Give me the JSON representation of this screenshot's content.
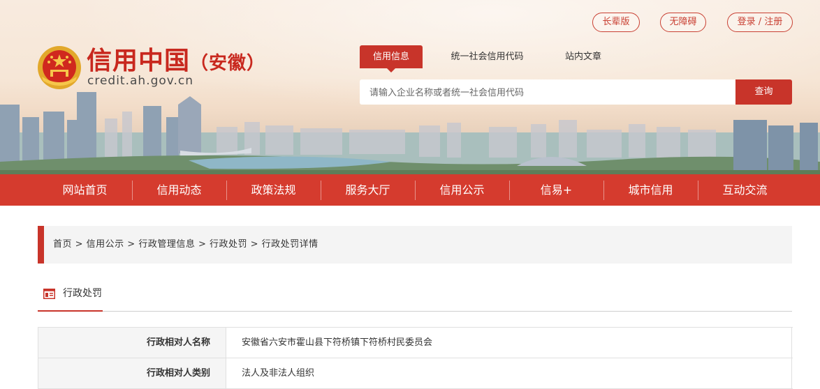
{
  "header": {
    "top_links": [
      "长辈版",
      "无障碍",
      "登录 / 注册"
    ],
    "logo": {
      "title": "信用中国",
      "subtitle": "（安徽）",
      "url": "credit.ah.gov.cn"
    },
    "search_tabs": [
      "信用信息",
      "统一社会信用代码",
      "站内文章"
    ],
    "search_placeholder": "请输入企业名称或者统一社会信用代码",
    "search_button": "查询"
  },
  "nav": [
    "网站首页",
    "信用动态",
    "政策法规",
    "服务大厅",
    "信用公示",
    "信易+",
    "城市信用",
    "互动交流"
  ],
  "breadcrumb": "首页 > 信用公示 >  行政管理信息 >  行政处罚 > 行政处罚详情",
  "section": {
    "title": "行政处罚"
  },
  "details": [
    {
      "label": "行政相对人名称",
      "value": "安徽省六安市霍山县下符桥镇下符桥村民委员会"
    },
    {
      "label": "行政相对人类别",
      "value": "法人及非法人组织"
    }
  ],
  "colors": {
    "brand_red": "#d53b2e",
    "accent_red": "#c8342a",
    "background": "#ffffff"
  },
  "icons": {
    "emblem": "national-emblem-icon",
    "section": "document-list-icon"
  }
}
